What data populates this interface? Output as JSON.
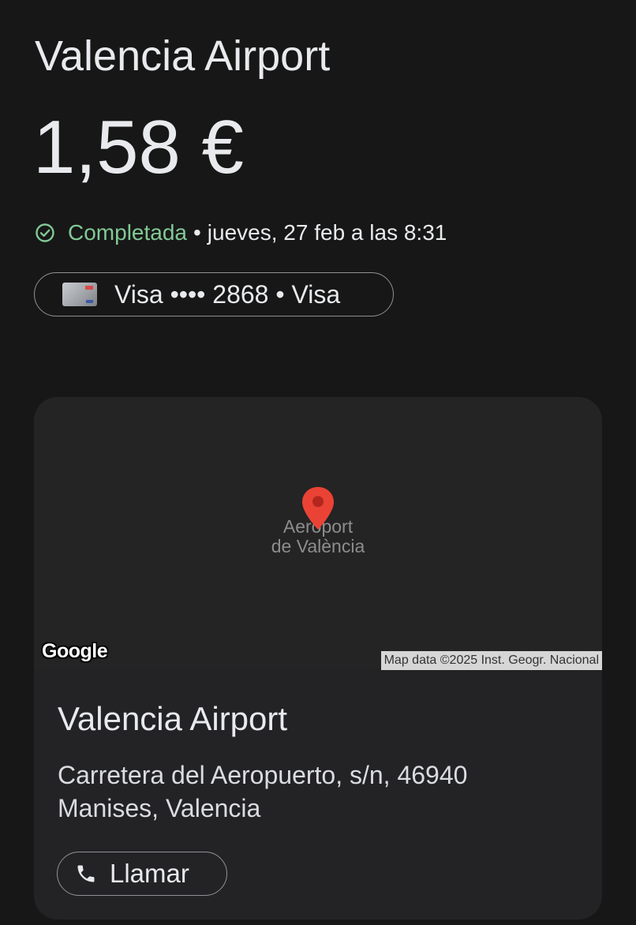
{
  "merchant": {
    "name": "Valencia Airport"
  },
  "transaction": {
    "amount": "1,58 €",
    "status": "Completada",
    "separator": "•",
    "datetime": "jueves, 27 feb a las 8:31",
    "status_color": "#81c995"
  },
  "payment_method": {
    "label": "Visa •••• 2868 • Visa",
    "icon": "card-thumbnail-icon"
  },
  "place": {
    "map": {
      "pin_color": "#ea4335",
      "map_label_line1": "Aeroport",
      "map_label_line2": "de València",
      "logo_text": "Google",
      "attribution": "Map data ©2025 Inst. Geogr. Nacional"
    },
    "name": "Valencia Airport",
    "address": "Carretera del Aeropuerto, s/n, 46940 Manises, Valencia",
    "call_label": "Llamar",
    "call_icon": "phone-icon"
  },
  "colors": {
    "background": "#171717",
    "card_background": "#232325",
    "text": "#e8eaed",
    "outline": "#8f9194"
  }
}
